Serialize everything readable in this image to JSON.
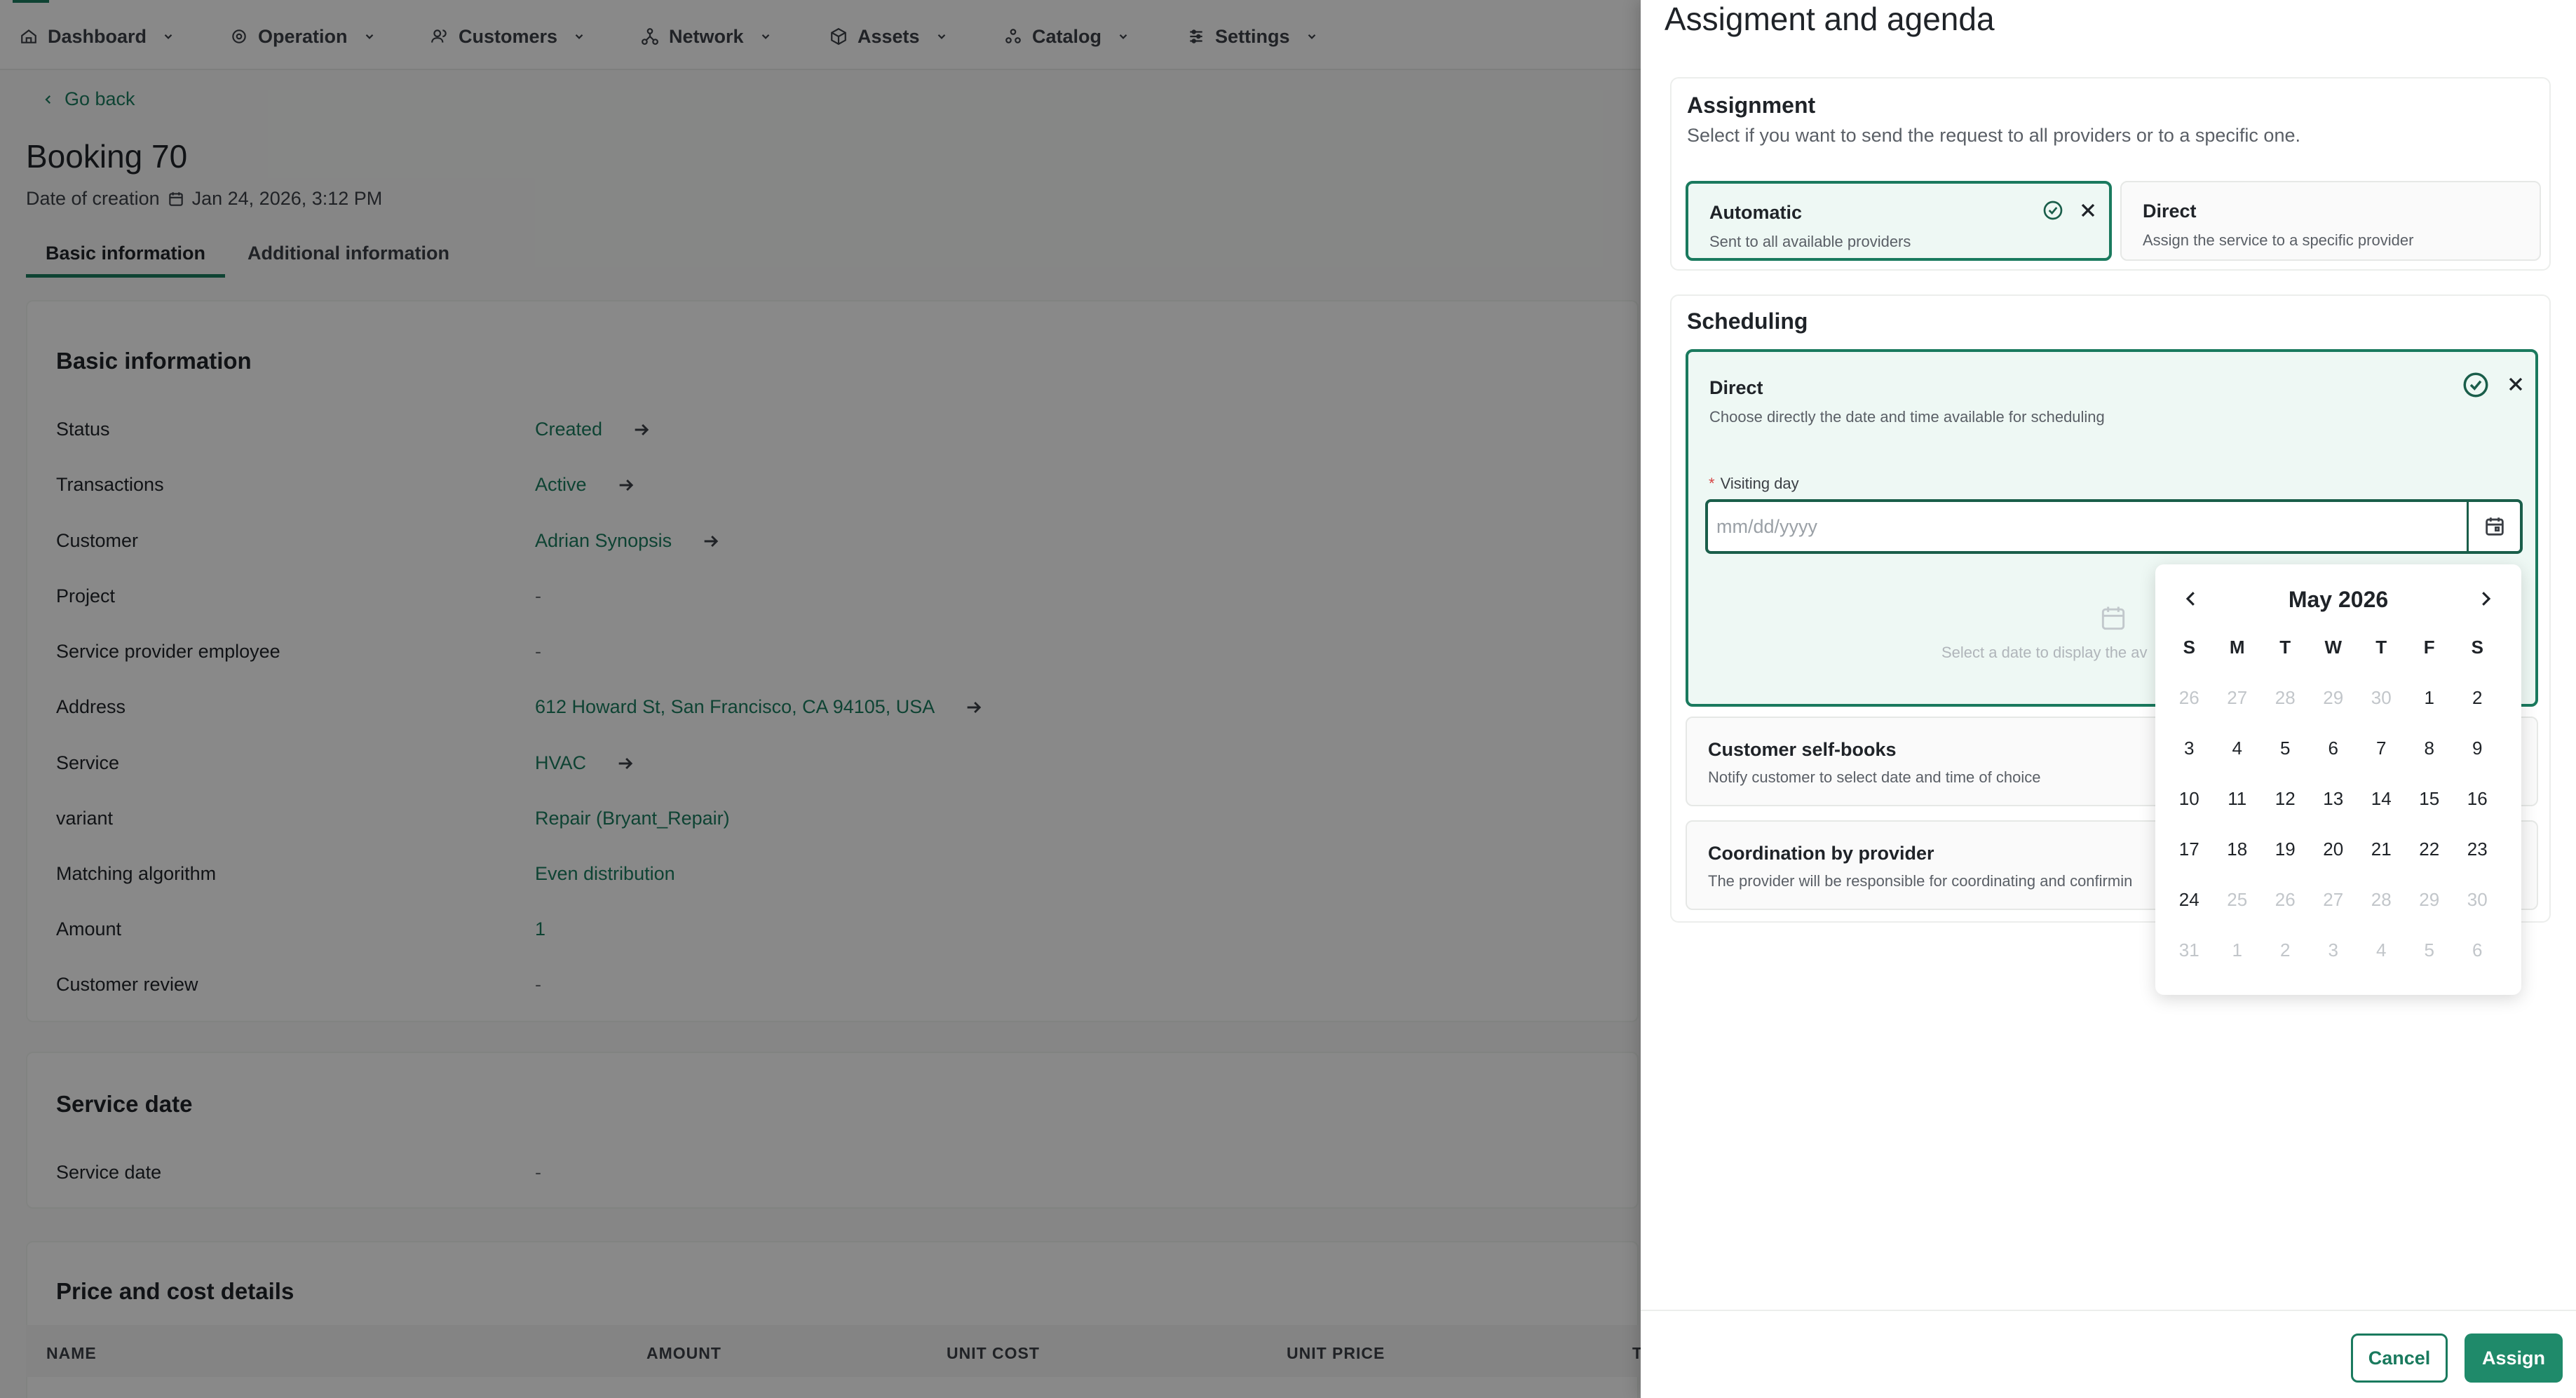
{
  "nav": {
    "items": [
      {
        "label": "Dashboard",
        "icon": "home-icon"
      },
      {
        "label": "Operation",
        "icon": "gear-icon"
      },
      {
        "label": "Customers",
        "icon": "users-icon"
      },
      {
        "label": "Network",
        "icon": "network-icon"
      },
      {
        "label": "Assets",
        "icon": "box-icon"
      },
      {
        "label": "Catalog",
        "icon": "catalog-icon"
      },
      {
        "label": "Settings",
        "icon": "sliders-icon"
      }
    ]
  },
  "page": {
    "go_back": "Go back",
    "title": "Booking 70",
    "creation_label": "Date of creation",
    "creation_date": "Jan 24, 2026, 3:12 PM",
    "tabs": [
      "Basic information",
      "Additional information"
    ]
  },
  "basic_info": {
    "title": "Basic information",
    "rows": [
      {
        "label": "Status",
        "value": "Created",
        "link": true
      },
      {
        "label": "Transactions",
        "value": "Active",
        "link": true
      },
      {
        "label": "Customer",
        "value": "Adrian Synopsis",
        "link": true
      },
      {
        "label": "Project",
        "value": "-",
        "link": false
      },
      {
        "label": "Service provider employee",
        "value": "-",
        "link": false
      },
      {
        "label": "Address",
        "value": "612 Howard St, San Francisco, CA 94105, USA",
        "link": true
      },
      {
        "label": "Service",
        "value": "HVAC",
        "link": true
      },
      {
        "label": "variant",
        "value": "Repair (Bryant_Repair)",
        "link": false
      },
      {
        "label": "Matching algorithm",
        "value": "Even distribution",
        "link": false
      },
      {
        "label": "Amount",
        "value": "1",
        "link": false
      },
      {
        "label": "Customer review",
        "value": "-",
        "link": false
      }
    ]
  },
  "service_date": {
    "title": "Service date",
    "label": "Service date",
    "value": "-"
  },
  "price": {
    "title": "Price and cost details",
    "columns": [
      "NAME",
      "AMOUNT",
      "UNIT COST",
      "UNIT PRICE",
      "T"
    ]
  },
  "drawer": {
    "title": "Assigment and agenda",
    "assignment": {
      "title": "Assignment",
      "subtitle": "Select if you want to send the request to all providers or to a specific one.",
      "options": [
        {
          "title": "Automatic",
          "subtitle": "Sent to all available providers",
          "selected": true
        },
        {
          "title": "Direct",
          "subtitle": "Assign the service to a specific provider",
          "selected": false
        }
      ]
    },
    "scheduling": {
      "title": "Scheduling",
      "direct": {
        "title": "Direct",
        "subtitle": "Choose directly the date and time available for scheduling",
        "field_label": "Visiting day",
        "placeholder": "mm/dd/yyyy",
        "empty_text": "Select a date to display the av"
      },
      "self_books": {
        "title": "Customer self-books",
        "subtitle": "Notify customer to select date and time of choice"
      },
      "coordination": {
        "title": "Coordination by provider",
        "subtitle": "The provider will be responsible for coordinating and confirmin"
      }
    },
    "calendar": {
      "month": "May 2026",
      "weekdays": [
        "S",
        "M",
        "T",
        "W",
        "T",
        "F",
        "S"
      ],
      "weeks": [
        [
          {
            "d": "26",
            "out": true
          },
          {
            "d": "27",
            "out": true
          },
          {
            "d": "28",
            "out": true
          },
          {
            "d": "29",
            "out": true
          },
          {
            "d": "30",
            "out": true
          },
          {
            "d": "1",
            "out": false
          },
          {
            "d": "2",
            "out": false
          }
        ],
        [
          {
            "d": "3",
            "out": false
          },
          {
            "d": "4",
            "out": false
          },
          {
            "d": "5",
            "out": false
          },
          {
            "d": "6",
            "out": false
          },
          {
            "d": "7",
            "out": false
          },
          {
            "d": "8",
            "out": false
          },
          {
            "d": "9",
            "out": false
          }
        ],
        [
          {
            "d": "10",
            "out": false
          },
          {
            "d": "11",
            "out": false
          },
          {
            "d": "12",
            "out": false
          },
          {
            "d": "13",
            "out": false
          },
          {
            "d": "14",
            "out": false
          },
          {
            "d": "15",
            "out": false
          },
          {
            "d": "16",
            "out": false
          }
        ],
        [
          {
            "d": "17",
            "out": false
          },
          {
            "d": "18",
            "out": false
          },
          {
            "d": "19",
            "out": false
          },
          {
            "d": "20",
            "out": false
          },
          {
            "d": "21",
            "out": false
          },
          {
            "d": "22",
            "out": false
          },
          {
            "d": "23",
            "out": false
          }
        ],
        [
          {
            "d": "24",
            "out": false
          },
          {
            "d": "25",
            "out": true
          },
          {
            "d": "26",
            "out": true
          },
          {
            "d": "27",
            "out": true
          },
          {
            "d": "28",
            "out": true
          },
          {
            "d": "29",
            "out": true
          },
          {
            "d": "30",
            "out": true
          }
        ],
        [
          {
            "d": "31",
            "out": true
          },
          {
            "d": "1",
            "out": true
          },
          {
            "d": "2",
            "out": true
          },
          {
            "d": "3",
            "out": true
          },
          {
            "d": "4",
            "out": true
          },
          {
            "d": "5",
            "out": true
          },
          {
            "d": "6",
            "out": true
          }
        ]
      ]
    },
    "footer": {
      "cancel": "Cancel",
      "assign": "Assign"
    }
  },
  "colors": {
    "accent": "#1a7a5e",
    "selected_bg": "#eef8f4",
    "overlay": "rgba(0,0,0,0.45)"
  }
}
